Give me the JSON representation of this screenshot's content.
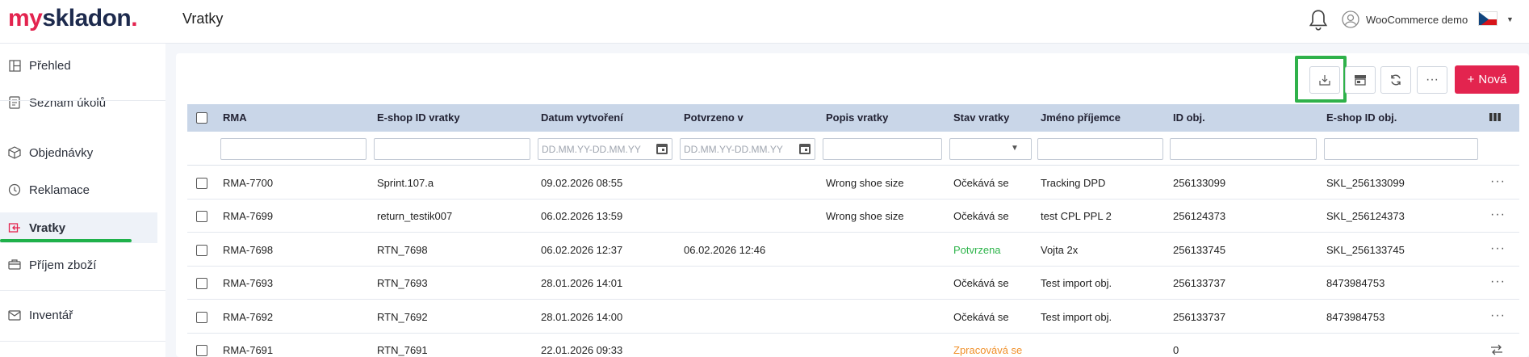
{
  "brand": {
    "part1": "my",
    "part2": "skladon",
    "dot": "."
  },
  "header": {
    "title": "Vratky",
    "user_name": "WooCommerce demo"
  },
  "sidebar": {
    "items": [
      {
        "label": "Přehled",
        "icon": "dashboard-icon"
      },
      {
        "label": "Seznam úkolů",
        "icon": "task-list-icon"
      },
      {
        "label": "Objednávky",
        "icon": "box-icon"
      },
      {
        "label": "Reklamace",
        "icon": "complaint-icon"
      },
      {
        "label": "Vratky",
        "icon": "return-icon",
        "active": true
      },
      {
        "label": "Příjem zboží",
        "icon": "truck-icon"
      },
      {
        "label": "Inventář",
        "icon": "inventory-icon"
      }
    ]
  },
  "toolbar": {
    "new_label": "Nová",
    "more_label": "···"
  },
  "table": {
    "columns": [
      "RMA",
      "E-shop ID vratky",
      "Datum vytvoření",
      "Potvrzeno v",
      "Popis vratky",
      "Stav vratky",
      "Jméno příjemce",
      "ID obj.",
      "E-shop ID obj."
    ],
    "date_placeholder": "DD.MM.YY-DD.MM.YY",
    "rows": [
      {
        "rma": "RMA-7700",
        "eshop_id": "Sprint.107.a",
        "created": "09.02.2026 08:55",
        "confirmed": "",
        "desc": "Wrong shoe size",
        "status": "Očekává se",
        "status_color": "#222222",
        "recipient": "Tracking DPD",
        "order_id": "256133099",
        "eshop_order_id": "SKL_256133099",
        "action": "···"
      },
      {
        "rma": "RMA-7699",
        "eshop_id": "return_testik007",
        "created": "06.02.2026 13:59",
        "confirmed": "",
        "desc": "Wrong shoe size",
        "status": "Očekává se",
        "status_color": "#222222",
        "recipient": "test CPL PPL 2",
        "order_id": "256124373",
        "eshop_order_id": "SKL_256124373",
        "action": "···"
      },
      {
        "rma": "RMA-7698",
        "eshop_id": "RTN_7698",
        "created": "06.02.2026 12:37",
        "confirmed": "06.02.2026 12:46",
        "desc": "",
        "status": "Potvrzena",
        "status_color": "#2db44a",
        "recipient": "Vojta 2x",
        "order_id": "256133745",
        "eshop_order_id": "SKL_256133745",
        "action": "···"
      },
      {
        "rma": "RMA-7693",
        "eshop_id": "RTN_7693",
        "created": "28.01.2026 14:01",
        "confirmed": "",
        "desc": "",
        "status": "Očekává se",
        "status_color": "#222222",
        "recipient": "Test import obj.",
        "order_id": "256133737",
        "eshop_order_id": "8473984753",
        "action": "···"
      },
      {
        "rma": "RMA-7692",
        "eshop_id": "RTN_7692",
        "created": "28.01.2026 14:00",
        "confirmed": "",
        "desc": "",
        "status": "Očekává se",
        "status_color": "#222222",
        "recipient": "Test import obj.",
        "order_id": "256133737",
        "eshop_order_id": "8473984753",
        "action": "···"
      },
      {
        "rma": "RMA-7691",
        "eshop_id": "RTN_7691",
        "created": "22.01.2026 09:33",
        "confirmed": "",
        "desc": "",
        "status": "Zpracovává se",
        "status_color": "#f0902a",
        "recipient": "",
        "order_id": "0",
        "eshop_order_id": "",
        "action": ""
      }
    ]
  },
  "colors": {
    "brand_red": "#e3244f",
    "brand_navy": "#1d2a4d",
    "accent_green": "#2fb14a",
    "header_row": "#c9d6e8"
  }
}
